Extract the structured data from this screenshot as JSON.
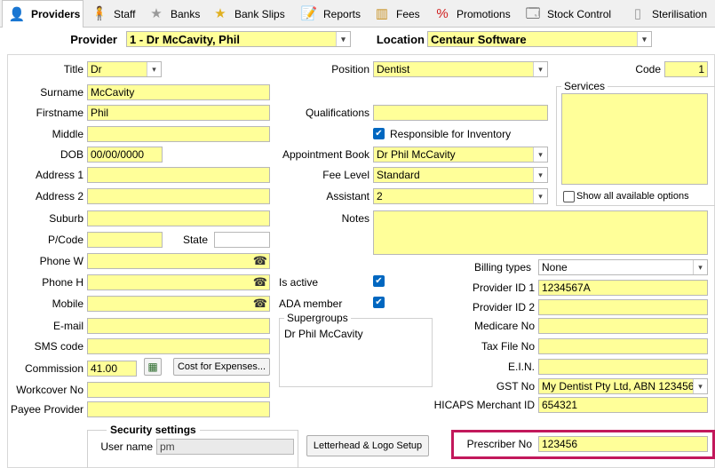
{
  "tabs": [
    {
      "label": "Providers",
      "icon": "person-icon"
    },
    {
      "label": "Staff",
      "icon": "staff-icon"
    },
    {
      "label": "Banks",
      "icon": "star-icon"
    },
    {
      "label": "Bank Slips",
      "icon": "star-icon"
    },
    {
      "label": "Reports",
      "icon": "report-icon"
    },
    {
      "label": "Fees",
      "icon": "coins-icon"
    },
    {
      "label": "Promotions",
      "icon": "percent-icon"
    },
    {
      "label": "Stock Control",
      "icon": "stock-icon"
    },
    {
      "label": "Sterilisation",
      "icon": "bottle-icon"
    }
  ],
  "header": {
    "provider_label": "Provider",
    "provider_value": "1 - Dr McCavity, Phil",
    "location_label": "Location",
    "location_value": "Centaur Software"
  },
  "left": {
    "title_label": "Title",
    "title_value": "Dr",
    "surname_label": "Surname",
    "surname_value": "McCavity",
    "firstname_label": "Firstname",
    "firstname_value": "Phil",
    "middle_label": "Middle",
    "middle_value": "",
    "dob_label": "DOB",
    "dob_value": "00/00/0000",
    "address1_label": "Address 1",
    "address1_value": "",
    "address2_label": "Address 2",
    "address2_value": "",
    "suburb_label": "Suburb",
    "suburb_value": "",
    "pcode_label": "P/Code",
    "pcode_value": "",
    "state_label": "State",
    "state_value": "",
    "phonew_label": "Phone W",
    "phonew_value": "",
    "phoneh_label": "Phone H",
    "phoneh_value": "",
    "mobile_label": "Mobile",
    "mobile_value": "",
    "email_label": "E-mail",
    "email_value": "",
    "sms_label": "SMS code",
    "sms_value": "",
    "commission_label": "Commission",
    "commission_value": "41.00",
    "cost_button": "Cost for Expenses...",
    "workcover_label": "Workcover No",
    "workcover_value": "",
    "payee_label": "Payee Provider",
    "payee_value": ""
  },
  "middle": {
    "position_label": "Position",
    "position_value": "Dentist",
    "qualifications_label": "Qualifications",
    "qualifications_value": "",
    "responsible_label": "Responsible for Inventory",
    "appointment_label": "Appointment Book",
    "appointment_value": "Dr Phil McCavity",
    "fee_label": "Fee Level",
    "fee_value": "Standard",
    "assistant_label": "Assistant",
    "assistant_value": "2",
    "notes_label": "Notes",
    "notes_value": "",
    "active_label": "Is active",
    "ada_label": "ADA member",
    "supergroups_label": "Supergroups",
    "supergroups_items": [
      "Dr Phil McCavity"
    ]
  },
  "right": {
    "code_label": "Code",
    "code_value": "1",
    "services_label": "Services",
    "show_all_label": "Show all available options",
    "billing_label": "Billing types",
    "billing_value": "None",
    "pid1_label": "Provider ID 1",
    "pid1_value": "1234567A",
    "pid2_label": "Provider ID 2",
    "pid2_value": "",
    "medicare_label": "Medicare No",
    "medicare_value": "",
    "tfn_label": "Tax File No",
    "tfn_value": "",
    "ein_label": "E.I.N.",
    "ein_value": "",
    "gst_label": "GST No",
    "gst_value": "My Dentist Pty Ltd, ABN 123456",
    "hicaps_label": "HICAPS Merchant ID",
    "hicaps_value": "654321",
    "prescriber_label": "Prescriber No",
    "prescriber_value": "123456"
  },
  "security": {
    "title": "Security settings",
    "username_label": "User name",
    "username_value": "pm",
    "letterhead_button": "Letterhead & Logo Setup"
  },
  "colors": {
    "field": "#ffff99",
    "highlight": "#c2185b",
    "checkbox": "#0067c0"
  }
}
